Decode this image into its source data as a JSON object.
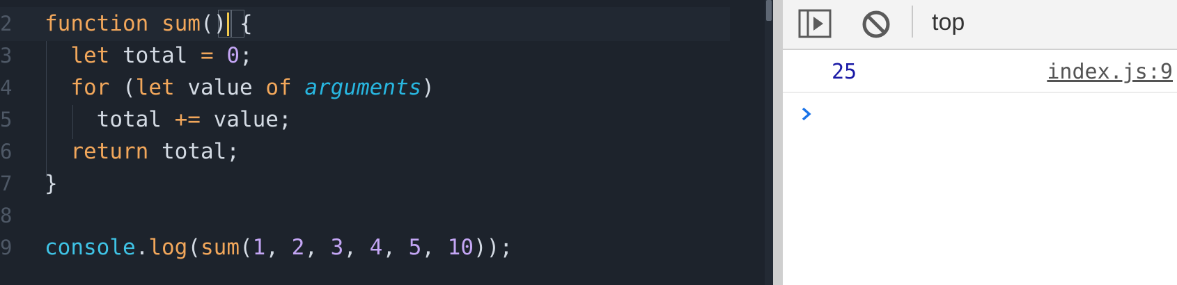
{
  "editor": {
    "lines": [
      {
        "num": "2",
        "tokens": [
          {
            "t": "function",
            "c": "kw"
          },
          {
            "t": " ",
            "c": "plain"
          },
          {
            "t": "sum",
            "c": "fn"
          },
          {
            "t": "(",
            "c": "punc"
          },
          {
            "t": ")",
            "c": "punc"
          },
          {
            "t": " {",
            "c": "punc"
          }
        ]
      },
      {
        "num": "3",
        "tokens": [
          {
            "t": "  ",
            "c": "plain"
          },
          {
            "t": "let",
            "c": "kw"
          },
          {
            "t": " total ",
            "c": "plain"
          },
          {
            "t": "=",
            "c": "op"
          },
          {
            "t": " ",
            "c": "plain"
          },
          {
            "t": "0",
            "c": "num"
          },
          {
            "t": ";",
            "c": "punc"
          }
        ]
      },
      {
        "num": "4",
        "tokens": [
          {
            "t": "  ",
            "c": "plain"
          },
          {
            "t": "for",
            "c": "kw"
          },
          {
            "t": " (",
            "c": "punc"
          },
          {
            "t": "let",
            "c": "kw"
          },
          {
            "t": " value ",
            "c": "plain"
          },
          {
            "t": "of",
            "c": "kw"
          },
          {
            "t": " ",
            "c": "plain"
          },
          {
            "t": "arguments",
            "c": "arg"
          },
          {
            "t": ")",
            "c": "punc"
          }
        ]
      },
      {
        "num": "5",
        "tokens": [
          {
            "t": "    total ",
            "c": "plain"
          },
          {
            "t": "+=",
            "c": "op"
          },
          {
            "t": " value;",
            "c": "plain"
          }
        ]
      },
      {
        "num": "6",
        "tokens": [
          {
            "t": "  ",
            "c": "plain"
          },
          {
            "t": "return",
            "c": "kw"
          },
          {
            "t": " total;",
            "c": "plain"
          }
        ]
      },
      {
        "num": "7",
        "tokens": [
          {
            "t": "}",
            "c": "punc"
          }
        ]
      },
      {
        "num": "8",
        "tokens": []
      },
      {
        "num": "9",
        "tokens": [
          {
            "t": "console",
            "c": "builtin"
          },
          {
            "t": ".",
            "c": "punc"
          },
          {
            "t": "log",
            "c": "fn"
          },
          {
            "t": "(",
            "c": "punc"
          },
          {
            "t": "sum",
            "c": "fn"
          },
          {
            "t": "(",
            "c": "punc"
          },
          {
            "t": "1",
            "c": "num"
          },
          {
            "t": ", ",
            "c": "punc"
          },
          {
            "t": "2",
            "c": "num"
          },
          {
            "t": ", ",
            "c": "punc"
          },
          {
            "t": "3",
            "c": "num"
          },
          {
            "t": ", ",
            "c": "punc"
          },
          {
            "t": "4",
            "c": "num"
          },
          {
            "t": ", ",
            "c": "punc"
          },
          {
            "t": "5",
            "c": "num"
          },
          {
            "t": ", ",
            "c": "punc"
          },
          {
            "t": "10",
            "c": "num"
          },
          {
            "t": "));",
            "c": "punc"
          }
        ]
      }
    ]
  },
  "console": {
    "toolbar": {
      "sidebar_icon": "sidebar-toggle-icon",
      "clear_icon": "clear-console-icon",
      "context": "top"
    },
    "messages": [
      {
        "value": "25",
        "source": "index.js:9"
      }
    ],
    "prompt_icon": "chevron-right-icon"
  },
  "colors": {
    "editor_bg": "#1d232c",
    "keyword": "#f2a75b",
    "number": "#c4a6f5",
    "builtin": "#3fc3e5",
    "cursor": "#f2c94c",
    "console_value": "#1a1aa6",
    "prompt": "#1a73e8"
  }
}
